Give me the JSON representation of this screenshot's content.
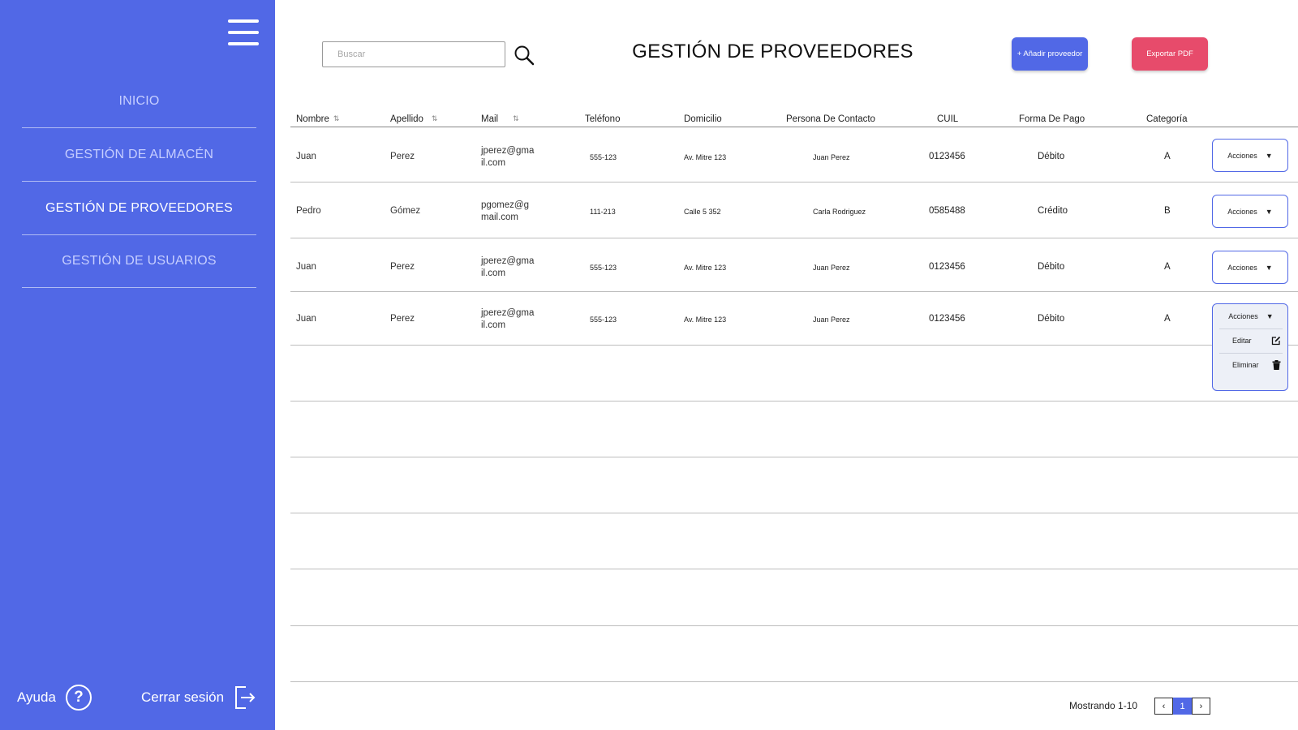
{
  "sidebar": {
    "items": [
      {
        "label": "INICIO"
      },
      {
        "label": "GESTIÓN DE ALMACÉN"
      },
      {
        "label": "GESTIÓN DE PROVEEDORES"
      },
      {
        "label": "GESTIÓN DE USUARIOS"
      }
    ],
    "help_label": "Ayuda",
    "help_icon": "?",
    "logout_label": "Cerrar sesión"
  },
  "header": {
    "search_placeholder": "Buscar",
    "title": "GESTIÓN DE PROVEEDORES",
    "add_label": "+ Añadir proveedor",
    "export_label": "Exportar PDF"
  },
  "table": {
    "columns": [
      "Nombre",
      "Apellido",
      "Mail",
      "Teléfono",
      "Domicilio",
      "Persona De Contacto",
      "CUIL",
      "Forma De Pago",
      "Categoría"
    ],
    "sort_icon": "⇅",
    "rows": [
      {
        "nombre": "Juan",
        "apellido": "Perez",
        "mail": "jperez@gmail.com",
        "telefono": "555-123",
        "domicilio": "Av. Mitre 123",
        "contacto": "Juan Perez",
        "cuil": "0123456",
        "pago": "Débito",
        "categoria": "A",
        "actions": "Acciones"
      },
      {
        "nombre": "Pedro",
        "apellido": "Gómez",
        "mail": "pgomez@gmail.com",
        "telefono": "111-213",
        "domicilio": "Calle 5 352",
        "contacto": "Carla Rodriguez",
        "cuil": "0585488",
        "pago": "Crédito",
        "categoria": "B",
        "actions": "Acciones"
      },
      {
        "nombre": "Juan",
        "apellido": "Perez",
        "mail": "jperez@gmail.com",
        "telefono": "555-123",
        "domicilio": "Av. Mitre 123",
        "contacto": "Juan Perez",
        "cuil": "0123456",
        "pago": "Débito",
        "categoria": "A",
        "actions": "Acciones"
      },
      {
        "nombre": "Juan",
        "apellido": "Perez",
        "mail": "jperez@gmail.com",
        "telefono": "555-123",
        "domicilio": "Av. Mitre 123",
        "contacto": "Juan Perez",
        "cuil": "0123456",
        "pago": "Débito",
        "categoria": "A",
        "actions": "Acciones"
      }
    ],
    "dropdown_arrow": "▼",
    "menu": {
      "edit_label": "Editar",
      "delete_label": "Eliminar"
    }
  },
  "pagination": {
    "showing": "Mostrando 1-10",
    "current_page": "1",
    "prev_icon": "‹",
    "next_icon": "›"
  },
  "colors": {
    "accent": "#5168e6",
    "danger": "#e74b6b"
  }
}
